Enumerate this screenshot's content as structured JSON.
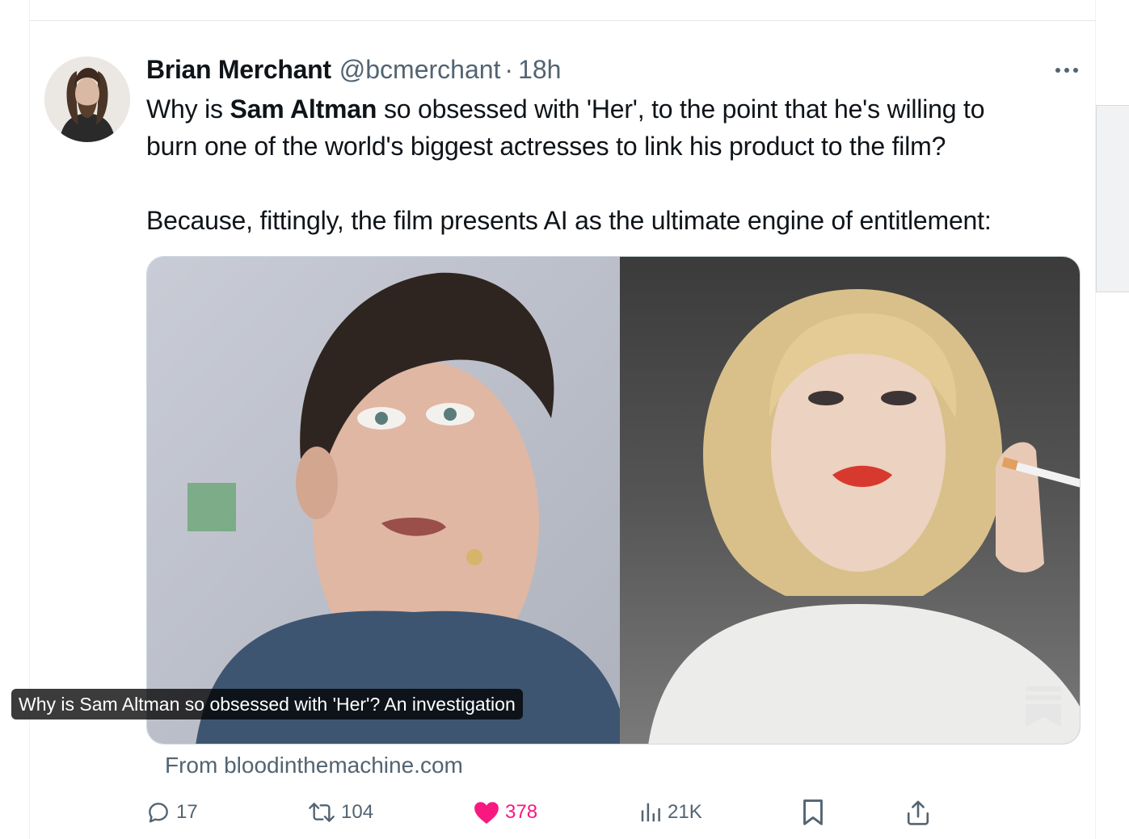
{
  "tweet": {
    "author_name": "Brian Merchant",
    "author_handle": "@bcmerchant",
    "separator": "·",
    "timestamp": "18h",
    "text_line1_a": "Why is ",
    "text_line1_mention": "Sam Altman",
    "text_line1_b": " so obsessed with 'Her', to the point that he's willing to",
    "text_line2": "burn one of the world's biggest actresses to link his product to the film?",
    "text_line3": "Because, fittingly, the film presents AI as the ultimate engine of entitlement:"
  },
  "card": {
    "title": "Why is Sam Altman so obsessed with 'Her'? An investigation",
    "source": "From bloodinthemachine.com"
  },
  "actions": {
    "replies": "17",
    "reposts": "104",
    "likes": "378",
    "views": "21K"
  },
  "icons": {
    "more": "more-horizontal-icon",
    "reply": "reply-bubble-icon",
    "repost": "repost-icon",
    "like": "heart-icon",
    "views": "views-bar-chart-icon",
    "bookmark": "bookmark-icon",
    "share": "share-upload-icon",
    "source_logo": "substack-logo-icon"
  },
  "colors": {
    "text_primary": "#0f1419",
    "text_secondary": "#536471",
    "like_pink": "#f91880",
    "border": "#cfd9de"
  }
}
